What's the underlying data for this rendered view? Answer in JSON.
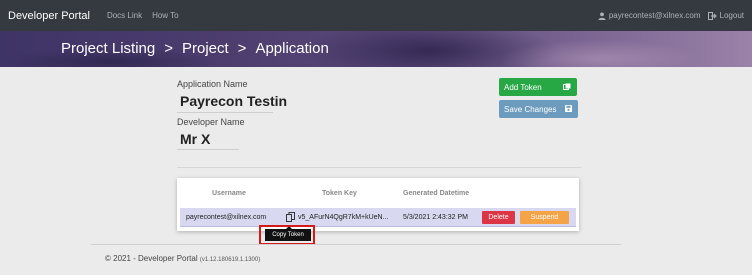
{
  "nav": {
    "brand": "Developer Portal",
    "links": [
      "Docs Link",
      "How To"
    ],
    "user_email": "payrecontest@xilnex.com",
    "logout": "Logout"
  },
  "breadcrumb": [
    "Project Listing",
    ">",
    "Project",
    ">",
    "Application"
  ],
  "form": {
    "app_name_label": "Application Name",
    "app_name_value": "Payrecon Testin",
    "dev_name_label": "Developer Name",
    "dev_name_value": "Mr X"
  },
  "buttons": {
    "add_token": "Add Token",
    "save_changes": "Save Changes"
  },
  "table": {
    "headers": [
      "Username",
      "Token Key",
      "Generated Datetime"
    ],
    "row": {
      "username": "payrecontest@xilnex.com",
      "token_key": "v5_AFurN4QgR7kM+kUeN...",
      "generated": "5/3/2021 2:43:32 PM",
      "delete_label": "Delete",
      "suspend_label": "Suspend"
    }
  },
  "tooltip": "Copy Token",
  "footer": {
    "text": "© 2021 - Developer Portal",
    "version": "(v1.12.180619.1.1300)"
  },
  "colors": {
    "navbar": "#343a40",
    "add_token": "#28a745",
    "save_changes": "#6c9bbd",
    "delete": "#dc3545",
    "suspend": "#f5a347",
    "highlight": "#d51a1a"
  }
}
